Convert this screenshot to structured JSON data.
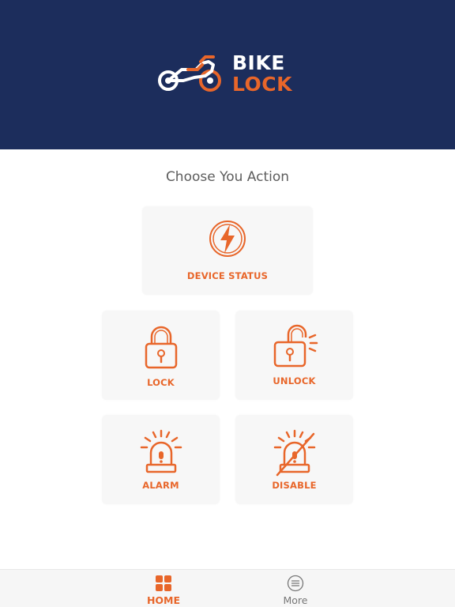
{
  "brand": {
    "line1": "BIKE",
    "line2": "LOCK"
  },
  "main": {
    "title": "Choose You Action",
    "actions": [
      {
        "label": "DEVICE STATUS",
        "icon": "lightning-icon"
      },
      {
        "label": "LOCK",
        "icon": "lock-icon"
      },
      {
        "label": "UNLOCK",
        "icon": "unlock-icon"
      },
      {
        "label": "ALARM",
        "icon": "siren-icon"
      },
      {
        "label": "DISABLE",
        "icon": "siren-off-icon"
      }
    ]
  },
  "tabbar": {
    "items": [
      {
        "label": "HOME",
        "icon": "grid-icon",
        "active": true
      },
      {
        "label": "More",
        "icon": "menu-circle-icon",
        "active": false
      }
    ]
  },
  "colors": {
    "header_bg": "#1c2d5c",
    "accent": "#e8662a",
    "card_bg": "#f7f7f7"
  }
}
